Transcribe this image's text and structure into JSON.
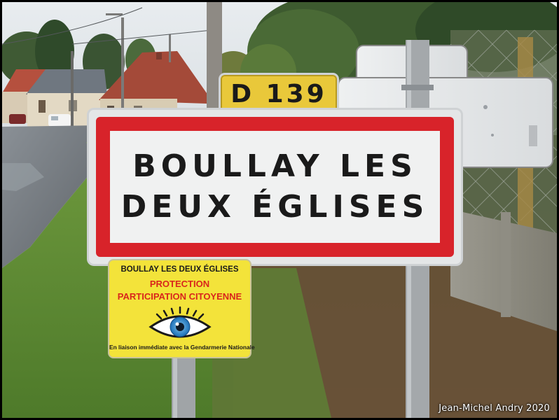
{
  "route_plate": {
    "text": "D 139",
    "color": "#e9c83a"
  },
  "town_sign": {
    "line1": "BOULLAY LES",
    "line2": "DEUX ÉGLISES",
    "border_color": "#d8232a"
  },
  "notice_sign": {
    "town": "BOULLAY LES DEUX ÉGLISES",
    "line1": "PROTECTION",
    "line2": "PARTICIPATION CITOYENNE",
    "footer": "En liaison immédiate avec la Gendarmerie Nationale",
    "icon": "eye-icon",
    "background": "#f3e33a",
    "accent_color": "#d9261c"
  },
  "credit": "Jean-Michel Andry 2020"
}
